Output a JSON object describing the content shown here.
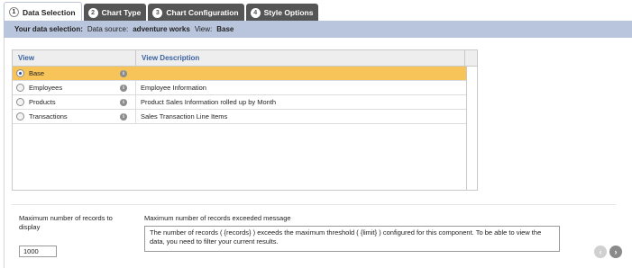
{
  "tabs": [
    {
      "num": "1",
      "label": "Data Selection",
      "active": true
    },
    {
      "num": "2",
      "label": "Chart Type",
      "active": false
    },
    {
      "num": "3",
      "label": "Chart Configuration",
      "active": false
    },
    {
      "num": "4",
      "label": "Style Options",
      "active": false
    }
  ],
  "selection": {
    "label": "Your data selection:",
    "source_prefix": "Data source:",
    "source": "adventure works",
    "view_prefix": "View:",
    "view": "Base"
  },
  "grid": {
    "columns": [
      "View",
      "View Description"
    ],
    "rows": [
      {
        "view": "Base",
        "description": "",
        "selected": true
      },
      {
        "view": "Employees",
        "description": "Employee Information",
        "selected": false
      },
      {
        "view": "Products",
        "description": "Product Sales Information rolled up by Month",
        "selected": false
      },
      {
        "view": "Transactions",
        "description": "Sales Transaction Line Items",
        "selected": false
      }
    ],
    "info_icon": "info-icon"
  },
  "form": {
    "max_records_label": "Maximum number of records to display",
    "max_records_value": "1000",
    "message_label": "Maximum number of records exceeded message",
    "message_value": "The number of records ( {records} ) exceeds the maximum threshold ( {limit} ) configured for this component. To be able to view the data, you need to filter your current results."
  },
  "nav": {
    "prev_icon": "chevron-left-icon",
    "next_icon": "chevron-right-icon"
  },
  "colors": {
    "selection_bar": "#b9c5dd",
    "selected_row": "#f7c45a",
    "inactive_tab": "#555555",
    "header_text": "#3a62a0"
  }
}
